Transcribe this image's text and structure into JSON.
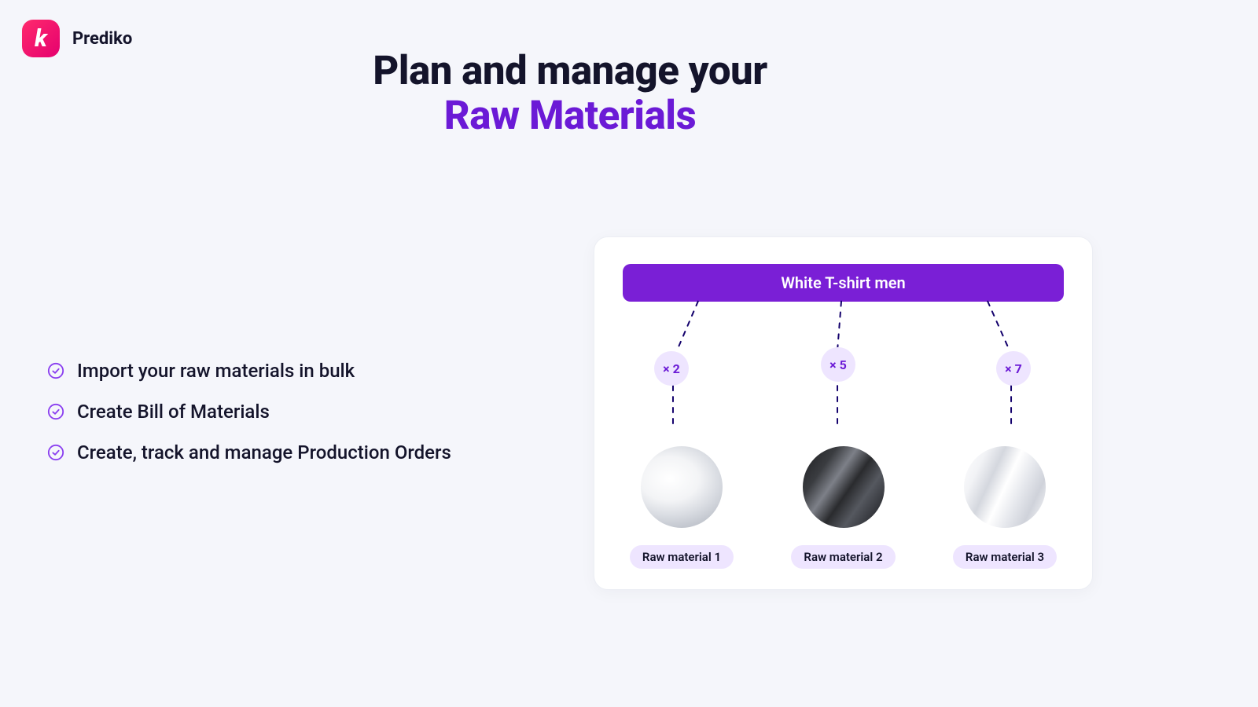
{
  "brand": {
    "name": "Prediko",
    "glyph": "k"
  },
  "heading": {
    "line1": "Plan and manage your",
    "line2": "Raw Materials"
  },
  "features": [
    "Import your raw materials in bulk",
    "Create Bill of Materials",
    "Create, track and manage Production Orders"
  ],
  "product": {
    "name": "White T-shirt men"
  },
  "materials": [
    {
      "qty": "× 2",
      "label": "Raw material 1"
    },
    {
      "qty": "× 5",
      "label": "Raw material 2"
    },
    {
      "qty": "× 7",
      "label": "Raw material 3"
    }
  ],
  "colors": {
    "accent": "#6b1ad6",
    "brand_badge": "#ff0b63"
  }
}
